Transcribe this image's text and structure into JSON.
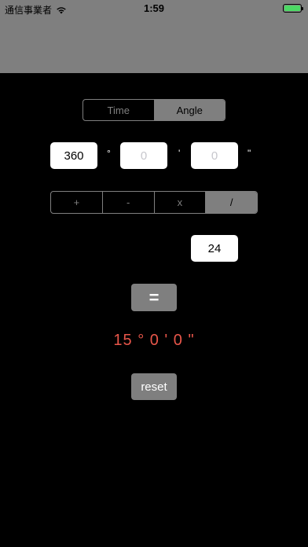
{
  "status": {
    "carrier": "通信事業者",
    "time": "1:59",
    "battery_level": 1.0
  },
  "mode_tabs": [
    {
      "label": "Time",
      "selected": false
    },
    {
      "label": "Angle",
      "selected": true
    }
  ],
  "angle": {
    "degrees_value": "360",
    "minutes_placeholder": "0",
    "seconds_placeholder": "0",
    "degree_symbol": "°",
    "minute_symbol": "'",
    "second_symbol": "\""
  },
  "operators": [
    {
      "label": "+",
      "selected": false
    },
    {
      "label": "-",
      "selected": false
    },
    {
      "label": "x",
      "selected": false
    },
    {
      "label": "/",
      "selected": true
    }
  ],
  "operand": "24",
  "equals_label": "=",
  "result": "15 ° 0 ' 0 \"",
  "reset_label": "reset",
  "colors": {
    "background": "#000000",
    "header": "#7f7f7f",
    "result": "#e8564a",
    "battery": "#4cd964"
  }
}
